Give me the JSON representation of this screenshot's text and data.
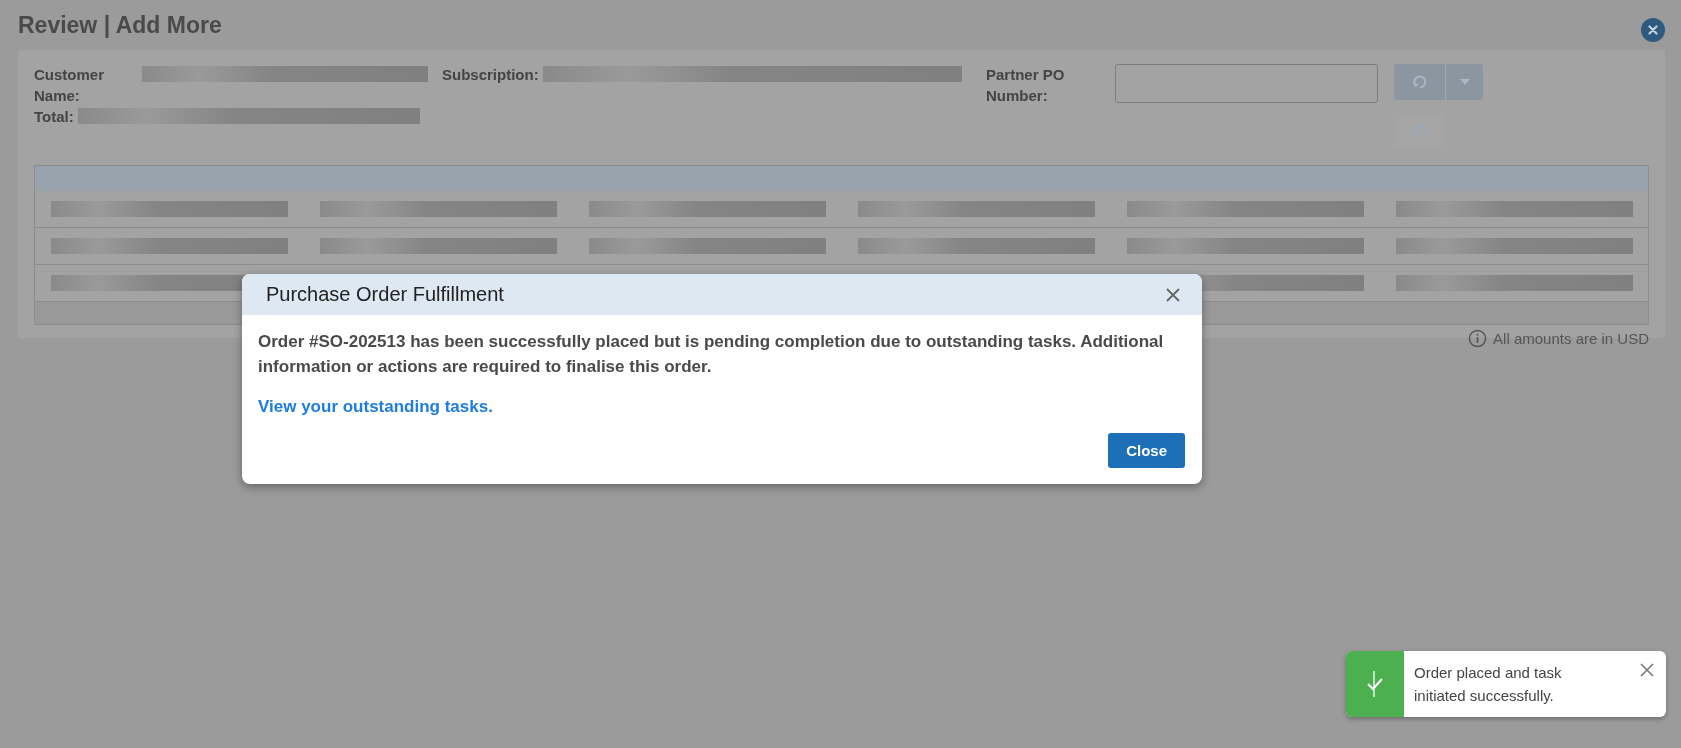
{
  "page": {
    "title": "Review | Add More"
  },
  "summary": {
    "customer_name_label": "Customer Name:",
    "total_label": "Total:",
    "subscription_label": "Subscription:",
    "partner_po_label": "Partner PO Number:"
  },
  "actions": [
    {
      "kind": "split",
      "disabled": true
    },
    {
      "kind": "single",
      "disabled": true
    }
  ],
  "footer_note": "All amounts are in USD",
  "dialog": {
    "title": "Purchase Order Fulfillment",
    "message": "Order #SO-202513 has been successfully placed but is pending completion due to outstanding tasks. Additional information or actions are required to finalise this order.",
    "link": "View your outstanding tasks.",
    "button": "Close"
  },
  "toast": {
    "kind": "success",
    "message": "Order placed and task initiated successfully."
  }
}
